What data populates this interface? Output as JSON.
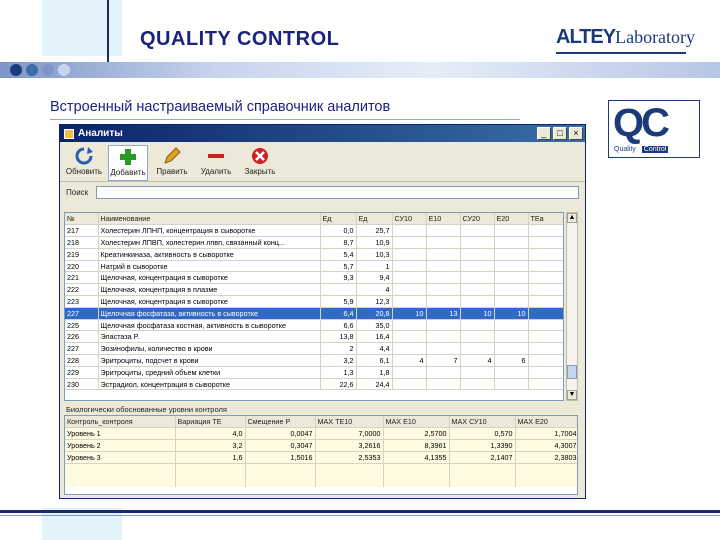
{
  "slide": {
    "title": "QUALITY CONTROL",
    "logo_bold": "ALTEY",
    "logo_light": "Laboratory",
    "subtitle": "Встроенный настраиваемый справочник аналитов",
    "qc_logo": {
      "letters": "QC",
      "word1": "Quality",
      "word2": "Control"
    }
  },
  "colors": {
    "navy": "#1a237e",
    "titlebar": "#0a246a",
    "selection": "#316ac5",
    "delete_red": "#d02020",
    "add_green": "#2a9a2a"
  },
  "window": {
    "title": "Аналиты",
    "controls": [
      "_",
      "□",
      "×"
    ],
    "toolbar": [
      {
        "label": "Обновить",
        "icon": "refresh-icon"
      },
      {
        "label": "Добавить",
        "icon": "add-icon"
      },
      {
        "label": "Править",
        "icon": "edit-icon"
      },
      {
        "label": "Удалить",
        "icon": "delete-icon"
      },
      {
        "label": "Закрыть",
        "icon": "close-icon"
      }
    ],
    "search_label": "Поиск",
    "search_value": ""
  },
  "analytes": {
    "columns": [
      "№",
      "Наименование",
      "Ед",
      "Ед",
      "СУ10",
      "Е10",
      "СУ20",
      "Е20",
      "ТЕа"
    ],
    "rows": [
      [
        "217",
        "Холестерин ЛПНП, концентрация в сыворотке",
        "0,0",
        "25,7",
        "",
        "",
        "",
        "",
        ""
      ],
      [
        "218",
        "Холестерин ЛПВП, холестерин лпвп, связанный конц...",
        "8,7",
        "10,9",
        "",
        "",
        "",
        "",
        ""
      ],
      [
        "219",
        "Креатинкиназа, активность в сыворотке",
        "5,4",
        "10,3",
        "",
        "",
        "",
        "",
        ""
      ],
      [
        "220",
        "Натрий в сыворотке",
        "5,7",
        "1",
        "",
        "",
        "",
        "",
        ""
      ],
      [
        "221",
        "Щелочная, концентрация в сыворотке",
        "9,3",
        "9,4",
        "",
        "",
        "",
        "",
        ""
      ],
      [
        "222",
        "Щелочная, концентрация в плазме",
        "",
        "4",
        "",
        "",
        "",
        "",
        ""
      ],
      [
        "223",
        "Щелочная, концентрация в сыворотке",
        "5,9",
        "12,3",
        "",
        "",
        "",
        "",
        ""
      ],
      [
        "227",
        "Щелочная фосфатаза, активность в сыворотке",
        "6,4",
        "20,8",
        "10",
        "13",
        "10",
        "10",
        ""
      ],
      [
        "225",
        "Щелочная фосфатаза костная, активность в сыворотке",
        "6,6",
        "35,0",
        "",
        "",
        "",
        "",
        ""
      ],
      [
        "226",
        "Эластаза Р.",
        "13,8",
        "16,4",
        "",
        "",
        "",
        "",
        ""
      ],
      [
        "227",
        "Эозинофилы, количество в крови",
        "2",
        "4,4",
        "",
        "",
        "",
        "",
        ""
      ],
      [
        "228",
        "Эритроциты, подсчет в крови",
        "3,2",
        "6,1",
        "4",
        "7",
        "4",
        "6",
        ""
      ],
      [
        "229",
        "Эритроциты, средний объем клетки",
        "1,3",
        "1,8",
        "",
        "",
        "",
        "",
        ""
      ],
      [
        "230",
        "Эстрадиол, концентрация в сыворотке",
        "22,6",
        "24,4",
        "",
        "",
        "",
        "",
        ""
      ]
    ]
  },
  "levels": {
    "label": "Биологически обоснованные уровни контроля",
    "columns": [
      "Контроль_контроля",
      "Вариация ТЕ",
      "Смещение Р",
      "МАХ ТЕ10",
      "МАХ Е10",
      "МАХ СУ10",
      "МАХ Е20"
    ],
    "rows": [
      [
        "Уровень 1",
        "4,0",
        "0,0047",
        "7,0000",
        "2,5700",
        "0,570",
        "1,7004"
      ],
      [
        "Уровень 2",
        "3,2",
        "0,3047",
        "3,2616",
        "8,3961",
        "1,3390",
        "4,3007"
      ],
      [
        "Уровень 3",
        "1,6",
        "1,5016",
        "2,5353",
        "4,1355",
        "2,1407",
        "2,3803"
      ]
    ]
  }
}
